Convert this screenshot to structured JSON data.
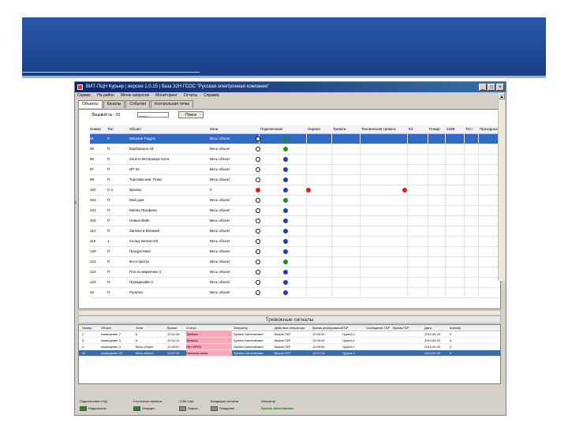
{
  "app": {
    "title": "ВИТ-ПЦН Курьер | версия 1.0.15 | база 32Н ГСОС \"Русская электронная компания\"",
    "menu": [
      "Сервис",
      "На район",
      "Меню запросов",
      "Мониторинг",
      "Отчеты",
      "Справка"
    ],
    "window_buttons": [
      "_",
      "□",
      "×"
    ],
    "tabs": [
      "Объекты",
      "Каналы",
      "События",
      "Контрольная точка"
    ],
    "active_tab": 0
  },
  "search": {
    "label": "Лицевой № - 91",
    "value": "____",
    "button": "Поиск"
  },
  "grid": {
    "headers": [
      "Номер",
      "Тип",
      "Объект",
      "Зона",
      "Подключение",
      "Охрана",
      "Тревога",
      "Техническая тревога",
      "КЗ",
      "Пожар",
      "220В",
      "Тест",
      "Проходные"
    ],
    "rows": [
      {
        "num": "91",
        "type": "П",
        "name": "Магазин Радуга",
        "zone": "Весь объект",
        "selected": true,
        "guard": "green"
      },
      {
        "num": "95",
        "type": "П",
        "name": "Барбершоп 33",
        "zone": "Весь объект",
        "guard": "green"
      },
      {
        "num": "96",
        "type": "П",
        "name": "Золото Интерьера Сити",
        "zone": "Весь объект",
        "guard": "blue"
      },
      {
        "num": "97",
        "type": "П",
        "name": "ИП 32",
        "zone": "Весь объект",
        "guard": "blue"
      },
      {
        "num": "98",
        "type": "П",
        "name": "Торговая инв. Плюс",
        "zone": "Весь объект",
        "guard": "blue"
      },
      {
        "num": "100",
        "type": "С-1",
        "name": "Брокер",
        "zone": "0",
        "guard": "blue",
        "conn_red": true,
        "alarm_red": true,
        "extra_red": true
      },
      {
        "num": "101",
        "type": "П",
        "name": "Мой дом",
        "zone": "Весь объект",
        "guard": "green"
      },
      {
        "num": "102",
        "type": "П",
        "name": "Милан Профили",
        "zone": "Весь объект",
        "guard": "blue"
      },
      {
        "num": "103",
        "type": "П",
        "name": "Новые Вейп",
        "zone": "Весь объект",
        "guard": "blue"
      },
      {
        "num": "114",
        "type": "П",
        "name": "Запчасти Великий",
        "zone": "Весь объект",
        "guard": "blue"
      },
      {
        "num": "115",
        "type": "1",
        "name": "Склад Запчастей",
        "zone": "Весь объект",
        "guard": "blue"
      },
      {
        "num": "120",
        "type": "П",
        "name": "Продуктовая",
        "zone": "Весь объект",
        "guard": "blue"
      },
      {
        "num": "121",
        "type": "П",
        "name": "Фото-Центр",
        "zone": "Весь объект",
        "guard": "green"
      },
      {
        "num": "122",
        "type": "П",
        "name": "Пол из маркетинг 2",
        "zone": "Весь объект",
        "guard": "blue"
      },
      {
        "num": "123",
        "type": "П",
        "name": "Промдизайн 3",
        "zone": "Весь объект",
        "guard": "blue"
      },
      {
        "num": "10",
        "type": "П",
        "name": "Рулетка",
        "zone": "Весь объект",
        "guard": "blue"
      }
    ]
  },
  "alarm_panel": {
    "title": "Тревожные сигналы",
    "headers": [
      "Номер",
      "Объект",
      "Зона",
      "Время",
      "Статус",
      "Оператор",
      "Действие оператора",
      "Время реагирования",
      "ГБР",
      "Сообщение ГБР",
      "Время ГБР",
      "Дата",
      "Шлейф"
    ],
    "rows": [
      {
        "num": "2",
        "obj": "помещение 2",
        "zone": "6",
        "time": "12:01:46",
        "status": "Тревога",
        "operator": "System Administrator",
        "action": "Вызов ГБР",
        "react": "12:05:00",
        "gbr": "Группа 1",
        "date": "2013.05.20",
        "loop": "0"
      },
      {
        "num": "3",
        "obj": "помещение 3",
        "zone": "6",
        "time": "12:02:10",
        "status": "Тревога",
        "operator": "System Administrator",
        "action": "Вызов ГБР",
        "react": "12:05:04",
        "gbr": "Группа 1",
        "date": "2013.05.20",
        "loop": "5"
      },
      {
        "num": "4",
        "obj": "помещение 4",
        "zone": "Весь объект",
        "time": "12:05:57",
        "status": "Нет GPRS",
        "operator": "System Administrator",
        "action": "Вызов ГБР",
        "react": "12:05:50",
        "gbr": "Группа 1",
        "date": "2013.05.20",
        "loop": "0"
      },
      {
        "num": "20",
        "obj": "помещение 20",
        "zone": "Весь объект",
        "time": "12:07:12",
        "status": "Пропала связь",
        "operator": "System Administrator",
        "action": "Вызов ГБР",
        "react": "12:07:24",
        "gbr": "Группа 1",
        "date": "2013.05.20",
        "loop": "5",
        "selected": true
      }
    ]
  },
  "statusbar": {
    "groups": [
      {
        "label": "Подключение к БД",
        "value": "Подключено",
        "color": "#1e8c1e"
      },
      {
        "label": "Состояние сервиса",
        "value": "Запущен",
        "color": "#1e8c1e"
      },
      {
        "label": "COM порт",
        "value": "Закрыт",
        "color": "#8a8a8a"
      },
      {
        "label": "Входящие сигналы",
        "value": "Ожидание",
        "color": "#8a8a8a"
      },
      {
        "label": "Оператор",
        "value": "System Administrator",
        "color": ""
      }
    ]
  },
  "colors": {
    "banner": "#2251a0",
    "selection": "#316ac5",
    "guard_green": "#1e8c1e",
    "guard_blue": "#1a3fb0",
    "alarm_red": "#d81e1e",
    "alarm_pink": "#f4a8b8"
  }
}
